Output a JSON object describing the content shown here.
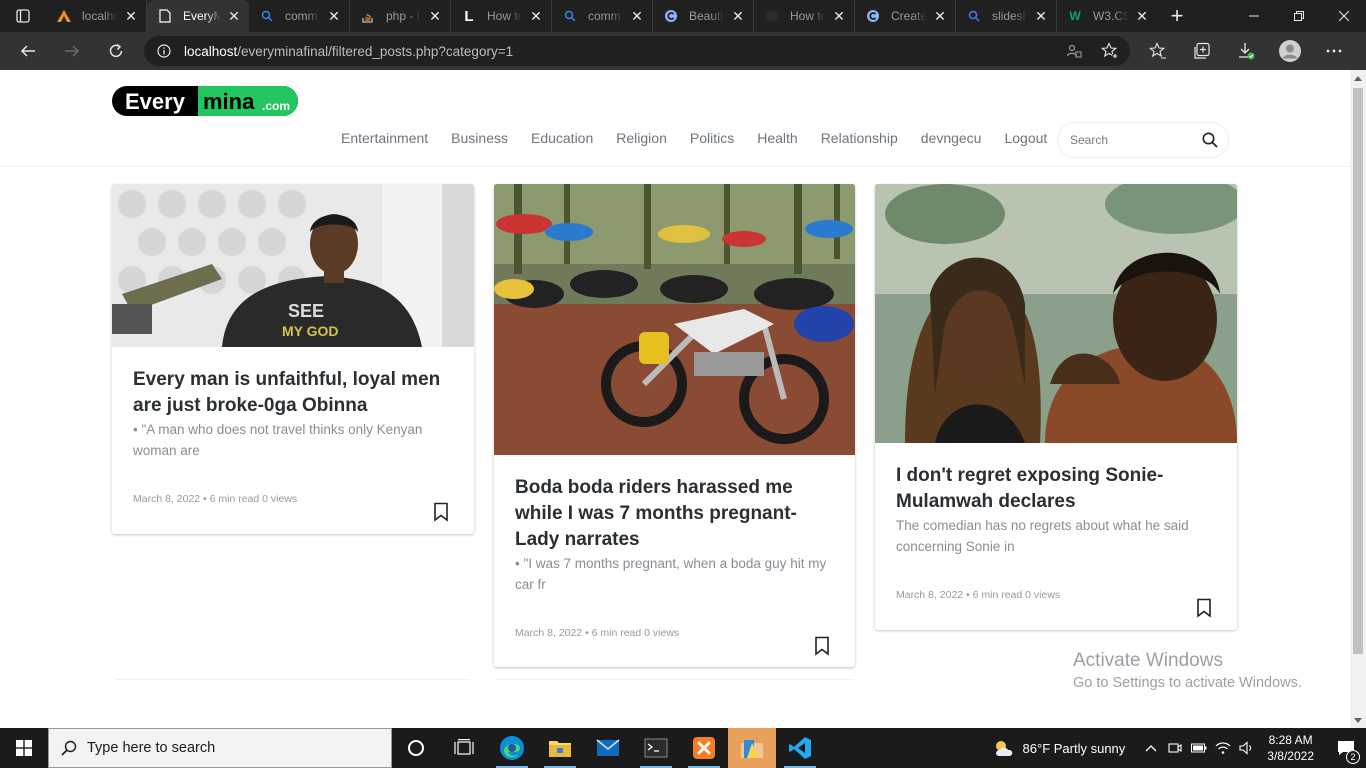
{
  "browser": {
    "tabs": [
      {
        "title": "localhost",
        "icon": "xampp-icon",
        "active": false
      },
      {
        "title": "EveryMina",
        "icon": "page-icon",
        "active": true
      },
      {
        "title": "comm",
        "icon": "search-icon",
        "active": false
      },
      {
        "title": "php - I",
        "icon": "stackoverflow-icon",
        "active": false
      },
      {
        "title": "How to",
        "icon": "letter-l-icon",
        "active": false
      },
      {
        "title": "comm",
        "icon": "search-icon",
        "active": false
      },
      {
        "title": "Beauti",
        "icon": "copilot-icon",
        "active": false
      },
      {
        "title": "How to",
        "icon": "github-icon",
        "active": false
      },
      {
        "title": "Create",
        "icon": "copilot-icon",
        "active": false
      },
      {
        "title": "slidesh",
        "icon": "search-icon",
        "active": false
      },
      {
        "title": "W3.CS",
        "icon": "w3-icon",
        "active": false
      }
    ],
    "url_host": "localhost",
    "url_path": "/everyminafinal/filtered_posts.php?category=1"
  },
  "site": {
    "logo_text_a": "Every",
    "logo_text_b": "mina",
    "logo_text_c": ".com",
    "nav": [
      "Entertainment",
      "Business",
      "Education",
      "Religion",
      "Politics",
      "Health",
      "Relationship",
      "devngecu",
      "Logout"
    ],
    "search_placeholder": "Search"
  },
  "posts": [
    {
      "title": "Every man is unfaithful, loyal men are just broke-0ga Obinna",
      "excerpt": "• \"A man who does not travel thinks only Kenyan woman are",
      "meta": "March 8, 2022 • 6 min read 0 views",
      "image": "Man in black t-shirt beside studio microphone"
    },
    {
      "title": "Boda boda riders harassed me while I was 7 months pregnant-Lady narrates",
      "excerpt": "• \"I was 7 months pregnant, when a boda guy hit my car fr",
      "meta": "March 8, 2022 • 6 min read 0 views",
      "image": "Parked motorcycles under umbrellas"
    },
    {
      "title": "I don't regret exposing Sonie-Mulamwah declares",
      "excerpt": "The comedian has no regrets about what he said concerning Sonie in",
      "meta": "March 8, 2022 • 6 min read 0 views",
      "image": "Couple posing for a selfie"
    }
  ],
  "watermark": {
    "line1": "Activate Windows",
    "line2": "Go to Settings to activate Windows."
  },
  "taskbar": {
    "search_placeholder": "Type here to search",
    "weather": "86°F  Partly sunny",
    "time": "8:28 AM",
    "date": "3/8/2022",
    "notifications": "2"
  },
  "colors": {
    "logo_green": "#22c55e",
    "logo_black": "#000000",
    "title_text": "#2a2f33",
    "muted_text": "#868e96"
  }
}
